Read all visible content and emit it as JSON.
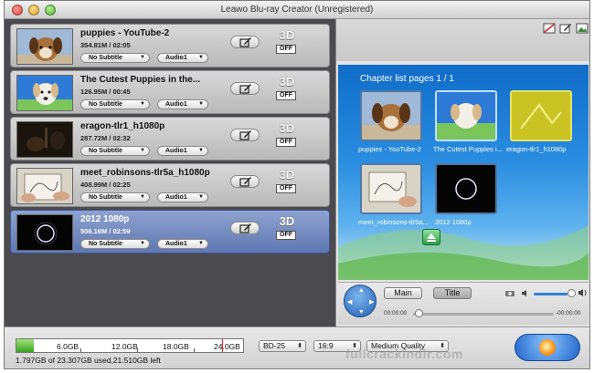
{
  "window": {
    "title": "Leawo Blu-ray Creator (Unregistered)"
  },
  "items": [
    {
      "name": "puppies - YouTube-2",
      "meta": "354.81M / 02:05",
      "subtitle": "No Subtitle",
      "audio": "Audio1",
      "td": "3D",
      "toggle": "OFF",
      "thumb": "puppy-brown"
    },
    {
      "name": "The Cutest Puppies in the...",
      "meta": "126.95M / 00:45",
      "subtitle": "No Subtitle",
      "audio": "Audio1",
      "td": "3D",
      "toggle": "OFF",
      "thumb": "puppy-white"
    },
    {
      "name": "eragon-tlr1_h1080p",
      "meta": "287.72M / 02:32",
      "subtitle": "No Subtitle",
      "audio": "Audio1",
      "td": "3D",
      "toggle": "OFF",
      "thumb": "dark"
    },
    {
      "name": "meet_robinsons-tlr5a_h1080p",
      "meta": "408.99M / 02:25",
      "subtitle": "No Subtitle",
      "audio": "Audio1",
      "td": "3D",
      "toggle": "OFF",
      "thumb": "sketch"
    },
    {
      "name": "2012 1080p",
      "meta": "506.16M / 02:59",
      "subtitle": "No Subtitle",
      "audio": "Audio1",
      "td": "3D",
      "toggle": "OFF",
      "thumb": "ring"
    }
  ],
  "preview": {
    "chapter_title": "Chapter list pages 1 / 1",
    "chapters": [
      {
        "label": "puppies - YouTube-2"
      },
      {
        "label": "The Cutest Puppies i..."
      },
      {
        "label": "eragon-tlr1_h1080p"
      },
      {
        "label": "meet_robinsons-tlr5a..."
      },
      {
        "label": "2012 1080p"
      }
    ]
  },
  "player": {
    "main_label": "Main",
    "title_label": "Title",
    "time_start": "00:00:00",
    "time_end": "-00:00:00",
    "seek_fraction": 0.0,
    "volume_fraction": 0.85
  },
  "bottom": {
    "capacity_marks": [
      "6.0GB",
      "12.0GB",
      "18.0GB",
      "24.0GB"
    ],
    "capacity_info": "1.797GB of 23.307GB used,21.510GB left",
    "used_fraction": 0.077,
    "disc_type": "BD-25",
    "aspect": "16:9",
    "quality": "Medium Quality"
  },
  "watermark": "fullcrackindir.com",
  "colors": {
    "selected_item": "#6f86bf",
    "panel_dark": "#4a4a4f",
    "menu_blue": "#2a8de0"
  }
}
